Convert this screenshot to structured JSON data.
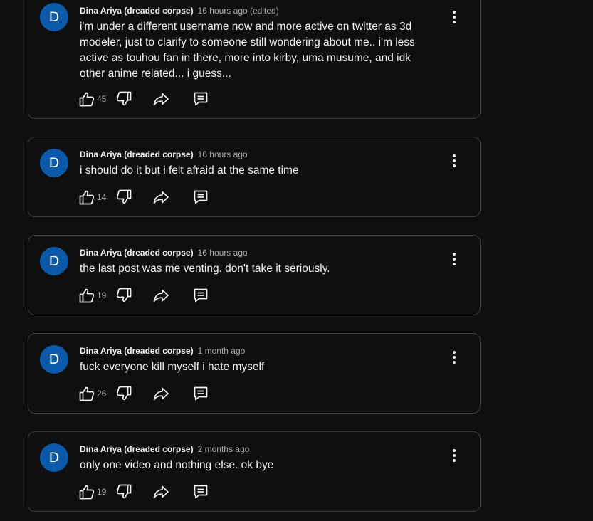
{
  "comments": [
    {
      "avatar_letter": "D",
      "author": "Dina Ariya (dreaded corpse)",
      "time": "16 hours ago (edited)",
      "text": "i'm under a different username now and more active on twitter as 3d modeler, just to clarify to someone still wondering about me.. i'm less active as touhou fan in there, more into kirby, uma musume, and idk other anime related... i guess...",
      "likes": "45"
    },
    {
      "avatar_letter": "D",
      "author": "Dina Ariya (dreaded corpse)",
      "time": "16 hours ago",
      "text": "i should do it but i felt afraid at the same time",
      "likes": "14"
    },
    {
      "avatar_letter": "D",
      "author": "Dina Ariya (dreaded corpse)",
      "time": "16 hours ago",
      "text": "the last post was me venting. don't take it seriously.",
      "likes": "19"
    },
    {
      "avatar_letter": "D",
      "author": "Dina Ariya (dreaded corpse)",
      "time": "1 month ago",
      "text": "fuck everyone kill myself i hate myself",
      "likes": "26"
    },
    {
      "avatar_letter": "D",
      "author": "Dina Ariya (dreaded corpse)",
      "time": "2 months ago",
      "text": "only one video and nothing else. ok bye",
      "likes": "19"
    }
  ],
  "icons": {
    "like": "thumb-up-icon",
    "dislike": "thumb-down-icon",
    "share": "share-icon",
    "reply": "reply-comment-icon",
    "more": "more-vertical-icon"
  },
  "colors": {
    "background": "#0f0f0f",
    "card_border": "#3a3a3a",
    "avatar": "#0b5aa9",
    "text_primary": "#f1f1f1",
    "text_secondary": "#aaaaaa"
  }
}
